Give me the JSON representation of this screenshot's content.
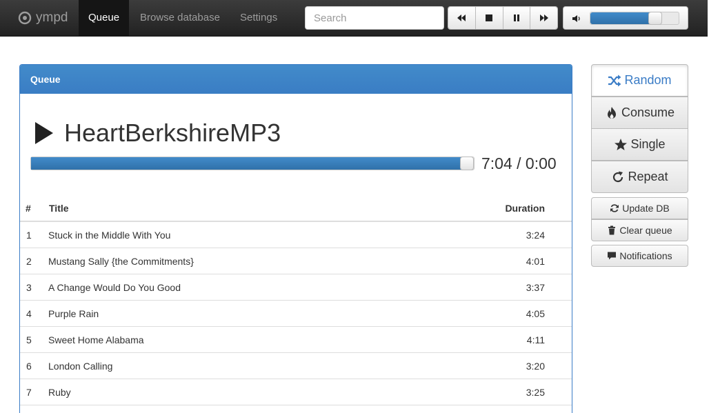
{
  "navbar": {
    "brand": "ympd",
    "tabs": [
      {
        "label": "Queue",
        "active": true
      },
      {
        "label": "Browse database",
        "active": false
      },
      {
        "label": "Settings",
        "active": false
      }
    ],
    "search_placeholder": "Search",
    "transport_icons": [
      "previous-icon",
      "stop-icon",
      "pause-icon",
      "next-icon"
    ],
    "volume_icon": "volume-icon",
    "volume_level": 0.78
  },
  "queue": {
    "heading": "Queue",
    "now_playing": {
      "icon": "play-icon",
      "title": "HeartBerkshireMP3",
      "counter": "7:04 / 0:00",
      "progress": 1.0
    },
    "columns": {
      "num": "#",
      "title": "Title",
      "duration": "Duration"
    },
    "rows": [
      {
        "num": "1",
        "title": "Stuck in the Middle With You",
        "duration": "3:24"
      },
      {
        "num": "2",
        "title": "Mustang Sally {the Commitments}",
        "duration": "4:01"
      },
      {
        "num": "3",
        "title": "A Change Would Do You Good",
        "duration": "3:37"
      },
      {
        "num": "4",
        "title": "Purple Rain",
        "duration": "4:05"
      },
      {
        "num": "5",
        "title": "Sweet Home Alabama",
        "duration": "4:11"
      },
      {
        "num": "6",
        "title": "London Calling",
        "duration": "3:20"
      },
      {
        "num": "7",
        "title": "Ruby",
        "duration": "3:25"
      }
    ]
  },
  "side": {
    "random": {
      "label": "Random",
      "icon": "shuffle-icon",
      "active": true
    },
    "consume": {
      "label": "Consume",
      "icon": "fire-icon",
      "active": false
    },
    "single": {
      "label": "Single",
      "icon": "star-icon",
      "active": false
    },
    "repeat": {
      "label": "Repeat",
      "icon": "repeat-icon",
      "active": false
    },
    "update_db": {
      "label": "Update DB",
      "icon": "refresh-icon"
    },
    "clear_queue": {
      "label": "Clear queue",
      "icon": "trash-icon"
    },
    "notifications": {
      "label": "Notifications",
      "icon": "comment-icon"
    }
  },
  "colors": {
    "accent": "#428bca",
    "navbar": "#222222"
  }
}
